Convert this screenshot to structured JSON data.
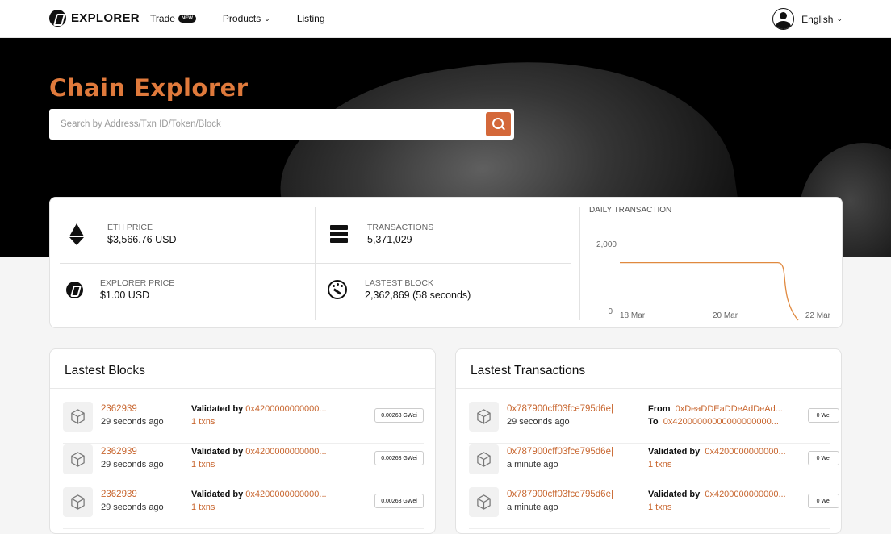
{
  "header": {
    "logo_text": "EXPLORER",
    "nav": [
      {
        "label": "Trade",
        "badge": "NEW"
      },
      {
        "label": "Products",
        "has_dropdown": true
      },
      {
        "label": "Listing"
      }
    ],
    "language": "English"
  },
  "hero": {
    "title": "Chain Explorer",
    "search_placeholder": "Search by Address/Txn ID/Token/Block"
  },
  "stats": {
    "eth_price": {
      "label": "ETH PRICE",
      "value": "$3,566.76 USD"
    },
    "transactions": {
      "label": "TRANSACTIONS",
      "value": "5,371,029"
    },
    "explorer_price": {
      "label": "EXPLORER PRICE",
      "value": "$1.00 USD"
    },
    "latest_block": {
      "label": "LASTEST BLOCK",
      "value": "2,362,869 (58 seconds)"
    }
  },
  "chart_data": {
    "type": "line",
    "title": "DAILY TRANSACTION",
    "x": [
      "18 Mar",
      "19 Mar",
      "20 Mar",
      "21 Mar",
      "22 Mar"
    ],
    "xticks": [
      "18 Mar",
      "20 Mar",
      "22 Mar"
    ],
    "series": [
      {
        "values": [
          1700,
          1700,
          1700,
          1700,
          0
        ]
      }
    ],
    "yticks": [
      "2,000",
      "0"
    ],
    "ylim": [
      0,
      2000
    ],
    "color": "#e0893f"
  },
  "blocks": {
    "title": "Lastest Blocks",
    "rows": [
      {
        "id": "2362939",
        "time": "29 seconds ago",
        "validated_label": "Validated by",
        "validator": "0x4200000000000...",
        "txns": "1 txns",
        "reward": "0.00263 GWei"
      },
      {
        "id": "2362939",
        "time": "29 seconds ago",
        "validated_label": "Validated by",
        "validator": "0x4200000000000...",
        "txns": "1 txns",
        "reward": "0.00263 GWei"
      },
      {
        "id": "2362939",
        "time": "29 seconds ago",
        "validated_label": "Validated by",
        "validator": "0x4200000000000...",
        "txns": "1 txns",
        "reward": "0.00263 GWei"
      }
    ]
  },
  "transactions": {
    "title": "Lastest Transactions",
    "rows": [
      {
        "hash": "0x787900cff03fce795d6e|",
        "time": "29 seconds ago",
        "line1_label": "From",
        "line1_value": "0xDeaDDEaDDeAdDeAd...",
        "line2_label": "To",
        "line2_value": "0x42000000000000000000...",
        "amount": "0 Wei"
      },
      {
        "hash": "0x787900cff03fce795d6e|",
        "time": "a minute ago",
        "line1_label": "Validated by",
        "line1_value": "0x4200000000000...",
        "line2_label": "",
        "line2_value": "1 txns",
        "amount": "0 Wei"
      },
      {
        "hash": "0x787900cff03fce795d6e|",
        "time": "a minute ago",
        "line1_label": "Validated by",
        "line1_value": "0x4200000000000...",
        "line2_label": "",
        "line2_value": "1 txns",
        "amount": "0 Wei"
      }
    ]
  }
}
